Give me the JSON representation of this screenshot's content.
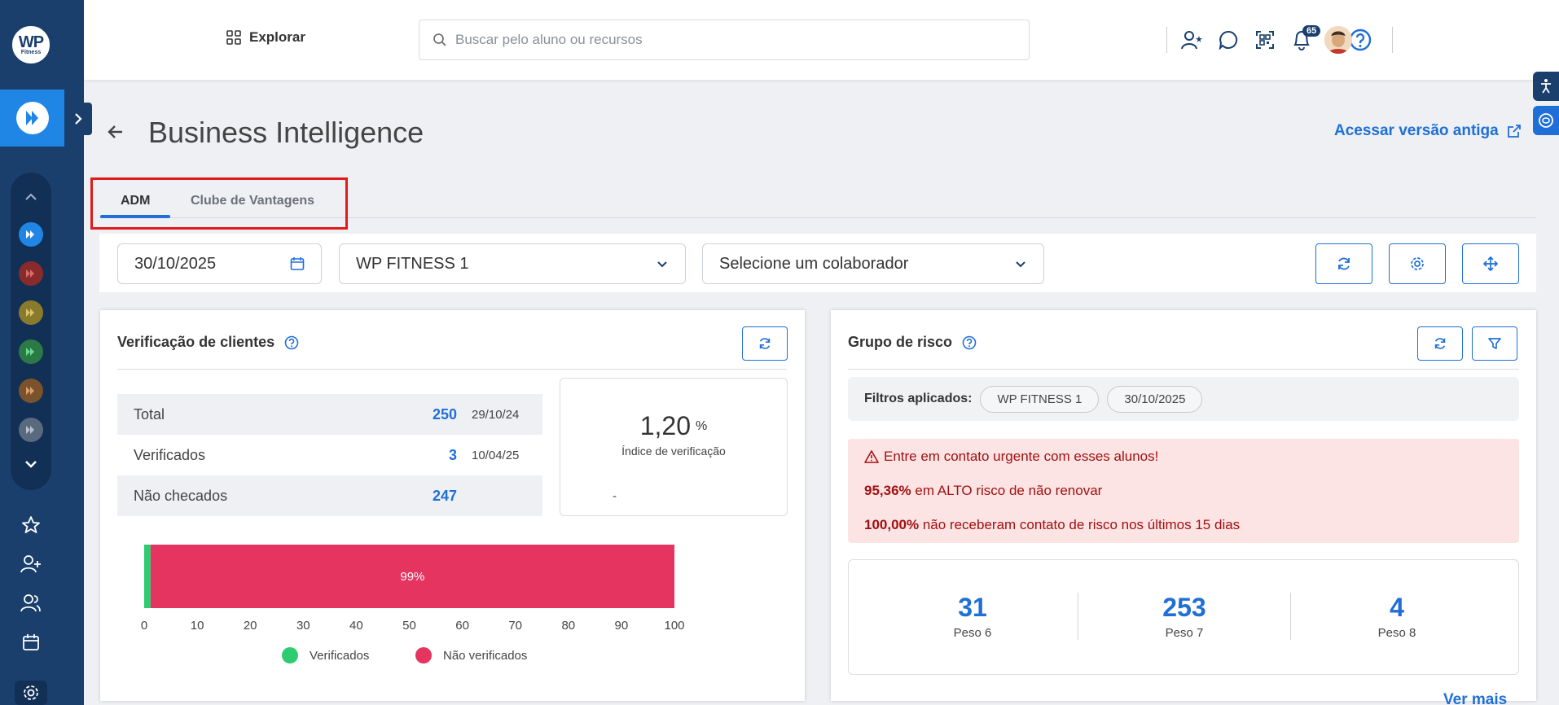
{
  "app": {
    "logo_text": "WP",
    "logo_sub": "Fitness",
    "notification_count": "65"
  },
  "header": {
    "explore_label": "Explorar",
    "search_placeholder": "Buscar pelo aluno ou recursos"
  },
  "page": {
    "title": "Business Intelligence",
    "old_version_link": "Acessar versão antiga"
  },
  "tabs": [
    {
      "label": "ADM",
      "active": true
    },
    {
      "label": "Clube de Vantagens",
      "active": false
    }
  ],
  "filters": {
    "date": "30/10/2025",
    "company": "WP FITNESS 1",
    "collaborator_placeholder": "Selecione um colaborador"
  },
  "verification_card": {
    "title": "Verificação de clientes",
    "rows": [
      {
        "label": "Total",
        "value": "250",
        "date": "29/10/24"
      },
      {
        "label": "Verificados",
        "value": "3",
        "date": "10/04/25"
      },
      {
        "label": "Não checados",
        "value": "247",
        "date": "-"
      }
    ],
    "index_value": "1,20",
    "index_unit": "%",
    "index_label": "Índice de verificação"
  },
  "chart_data": {
    "type": "bar",
    "orientation": "horizontal-stacked",
    "series": [
      {
        "name": "Verificados",
        "value": 1.2,
        "color": "#2ecc71"
      },
      {
        "name": "Não verificados",
        "value": 98.8,
        "color": "#e5345f"
      }
    ],
    "bar_label": "99%",
    "xlim": [
      0,
      100
    ],
    "x_ticks": [
      "0",
      "10",
      "20",
      "30",
      "40",
      "50",
      "60",
      "70",
      "80",
      "90",
      "100"
    ],
    "legend_position": "bottom"
  },
  "risk_card": {
    "title": "Grupo de risco",
    "filters_label": "Filtros aplicados:",
    "chips": [
      "WP FITNESS 1",
      "30/10/2025"
    ],
    "alert_title": "Entre em contato urgente com esses alunos!",
    "alert_line1_bold": "95,36%",
    "alert_line1_text": " em ALTO risco de não renovar",
    "alert_line2_bold": "100,00%",
    "alert_line2_text": " não receberam contato de risco nos últimos 15 dias",
    "pesos": [
      {
        "value": "31",
        "label": "Peso 6"
      },
      {
        "value": "253",
        "label": "Peso 7"
      },
      {
        "value": "4",
        "label": "Peso 8"
      }
    ],
    "see_more": "Ver mais"
  },
  "colors": {
    "sidebar": "#1a3f6d",
    "accent": "#1f6fd6",
    "verified": "#2ecc71",
    "unverified": "#e5345f",
    "alert_bg": "#fde4e4"
  }
}
